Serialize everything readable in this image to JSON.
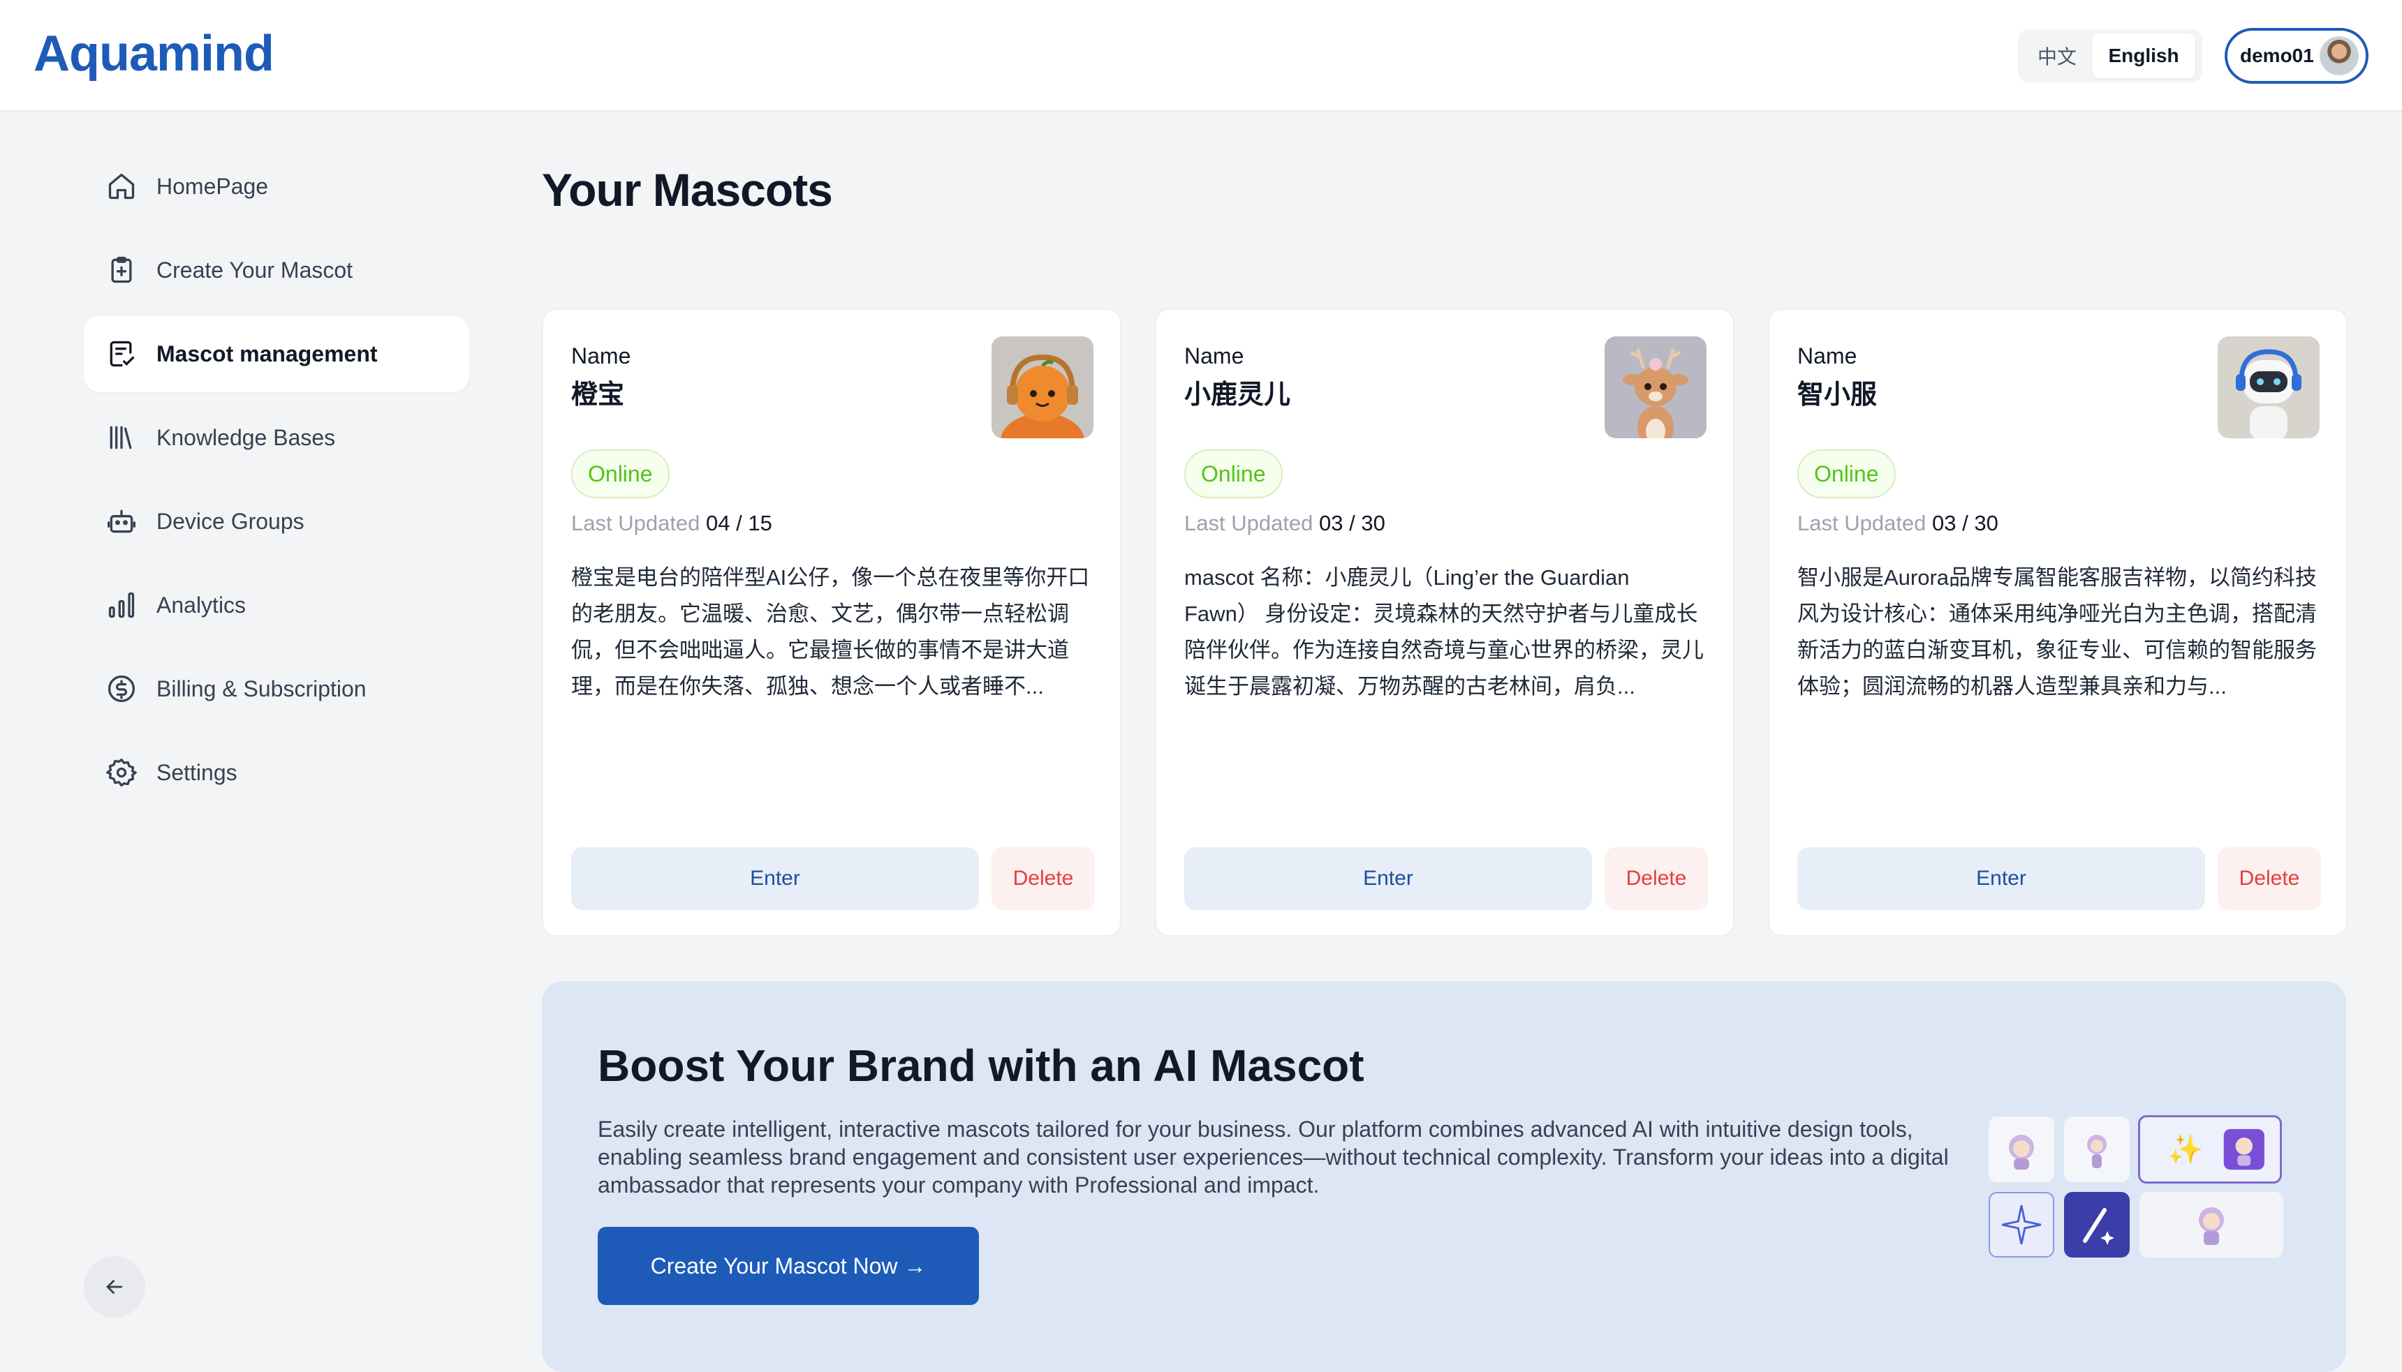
{
  "header": {
    "logo_text": "Aquamind",
    "lang_zh": "中文",
    "lang_en": "English",
    "user_name": "demo01"
  },
  "sidebar": {
    "items": [
      {
        "label": "HomePage",
        "icon": "home-icon"
      },
      {
        "label": "Create Your Mascot",
        "icon": "clipboard-plus-icon"
      },
      {
        "label": "Mascot management",
        "icon": "edit-list-icon",
        "active": true
      },
      {
        "label": "Knowledge Bases",
        "icon": "library-icon"
      },
      {
        "label": "Device Groups",
        "icon": "robot-icon"
      },
      {
        "label": "Analytics",
        "icon": "bar-chart-icon"
      },
      {
        "label": "Billing & Subscription",
        "icon": "dollar-circle-icon"
      },
      {
        "label": "Settings",
        "icon": "gear-icon"
      }
    ]
  },
  "main": {
    "title": "Your Mascots",
    "cards": [
      {
        "name_label": "Name",
        "name": "橙宝",
        "status": "Online",
        "updated_label": "Last Updated",
        "updated_value": "04 / 15",
        "description": "橙宝是电台的陪伴型AI公仔，像一个总在夜里等你开口的老朋友。它温暖、治愈、文艺，偶尔带一点轻松调侃，但不会咄咄逼人。它最擅长做的事情不是讲大道理，而是在你失落、孤独、想念一个人或者睡不...",
        "enter": "Enter",
        "delete": "Delete"
      },
      {
        "name_label": "Name",
        "name": "小鹿灵儿",
        "status": "Online",
        "updated_label": "Last Updated",
        "updated_value": "03 / 30",
        "description": "mascot 名称：小鹿灵儿（Ling’er the Guardian Fawn） 身份设定：灵境森林的天然守护者与儿童成长陪伴伙伴。作为连接自然奇境与童心世界的桥梁，灵儿诞生于晨露初凝、万物苏醒的古老林间，肩负...",
        "enter": "Enter",
        "delete": "Delete"
      },
      {
        "name_label": "Name",
        "name": "智小服",
        "status": "Online",
        "updated_label": "Last Updated",
        "updated_value": "03 / 30",
        "description": "智小服是Aurora品牌专属智能客服吉祥物，以简约科技风为设计核心：通体采用纯净哑光白为主色调，搭配清新活力的蓝白渐变耳机，象征专业、可信赖的智能服务体验；圆润流畅的机器人造型兼具亲和力与...",
        "enter": "Enter",
        "delete": "Delete"
      }
    ]
  },
  "promo": {
    "title": "Boost Your Brand with an AI Mascot",
    "text": "Easily create intelligent, interactive mascots tailored for your business. Our platform combines advanced AI with intuitive design tools, enabling seamless brand engagement and consistent user experiences—without technical complexity. Transform your ideas into a digital ambassador that represents your company with Professional and impact.",
    "button": "Create Your Mascot Now →"
  },
  "colors": {
    "brand": "#1e5bb8",
    "online": "#52c41a",
    "delete": "#e53e3e"
  }
}
